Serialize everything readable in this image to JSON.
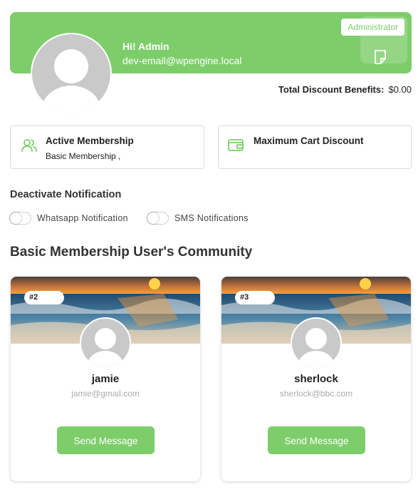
{
  "profile": {
    "greeting": "Hi! Admin",
    "email": "dev-email@wpengine.local",
    "role": "Administrator",
    "avatar_icon": "user-avatar-placeholder",
    "note_icon": "note-icon"
  },
  "discount": {
    "label": "Total Discount Benefits:",
    "value": "$0.00"
  },
  "cards": [
    {
      "icon": "users-icon",
      "title": "Active Membership",
      "subtitle": "Basic Membership ,"
    },
    {
      "icon": "wallet-icon",
      "title": "Maximum Cart Discount"
    }
  ],
  "notifications": {
    "heading": "Deactivate Notification",
    "toggles": [
      {
        "label": "Whatsapp Notification",
        "on": false
      },
      {
        "label": "SMS Notifications",
        "on": false
      }
    ]
  },
  "community": {
    "title": "Basic Membership User's Community",
    "members": [
      {
        "rank": "#2",
        "name": "jamie",
        "email": "jamie@gmail.com",
        "button": "Send Message"
      },
      {
        "rank": "#3",
        "name": "sherlock",
        "email": "sherlock@bbc.com",
        "button": "Send Message"
      }
    ]
  },
  "colors": {
    "accent": "#7dcd6a",
    "avatar_bg": "#c9c9c9"
  }
}
